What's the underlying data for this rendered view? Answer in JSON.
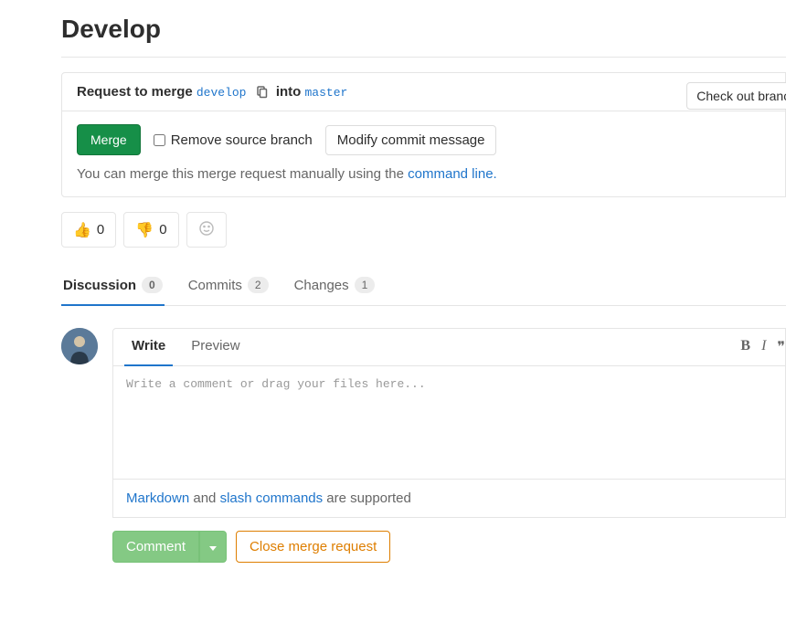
{
  "page_title": "Develop",
  "merge": {
    "request_prefix": "Request to merge",
    "source_branch": "develop",
    "into": "into",
    "target_branch": "master",
    "check_button": "Check out branch",
    "merge_button": "Merge",
    "remove_source_label": "Remove source branch",
    "modify_commit_button": "Modify commit message",
    "hint_prefix": "You can merge this merge request manually using the ",
    "hint_link": "command line."
  },
  "reactions": {
    "thumbs_up_count": "0",
    "thumbs_down_count": "0"
  },
  "tabs": {
    "discussion_label": "Discussion",
    "discussion_count": "0",
    "commits_label": "Commits",
    "commits_count": "2",
    "changes_label": "Changes",
    "changes_count": "1"
  },
  "comment": {
    "write_tab": "Write",
    "preview_tab": "Preview",
    "placeholder": "Write a comment or drag your files here...",
    "markdown_link": "Markdown",
    "support_and": " and ",
    "slash_link": "slash commands",
    "support_suffix": " are supported",
    "comment_button": "Comment",
    "close_mr_button": "Close merge request"
  }
}
